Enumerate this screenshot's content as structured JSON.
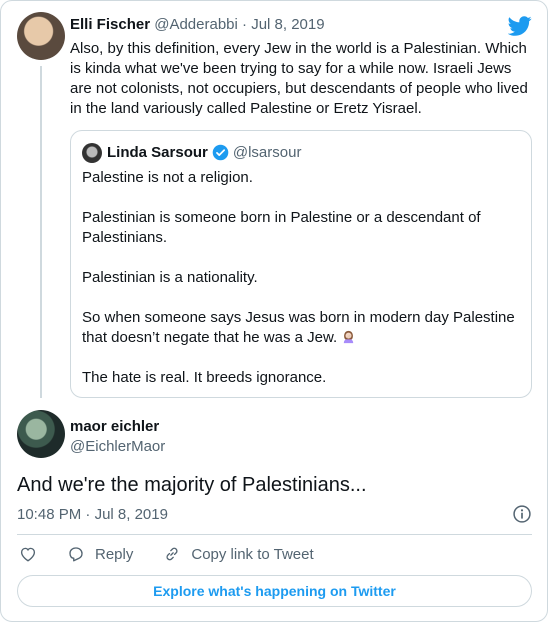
{
  "parent": {
    "name": "Elli Fischer",
    "handle": "@Adderabbi",
    "separator": "·",
    "date": "Jul 8, 2019",
    "text": "Also, by this definition, every Jew in the world is a Palestinian. Which is kinda what we've been trying to say for a while now. Israeli Jews are not colonists, not occupiers, but descendants of people who lived in the land variously called Palestine or Eretz Yisrael."
  },
  "quote": {
    "name": "Linda Sarsour",
    "handle": "@lsarsour",
    "paragraphs": [
      "Palestine is not a religion.",
      "Palestinian is someone born in Palestine or a descendant of Palestinians.",
      "Palestinian is a nationality.",
      "So when someone says Jesus was born in modern day Palestine that doesn’t negate that he was a Jew.",
      "The hate is real. It breeds ignorance."
    ],
    "emoji": "woman-facepalming"
  },
  "main": {
    "name": "maor eichler",
    "handle": "@EichlerMaor",
    "text": "And we're the majority of Palestinians...",
    "time": "10:48 PM",
    "separator": "·",
    "date": "Jul 8, 2019"
  },
  "actions": {
    "reply_label": "Reply",
    "copy_label": "Copy link to Tweet"
  },
  "explore_label": "Explore what's happening on Twitter",
  "colors": {
    "accent": "#1d9bf0",
    "secondary_text": "#536471",
    "border": "#cfd9de"
  }
}
